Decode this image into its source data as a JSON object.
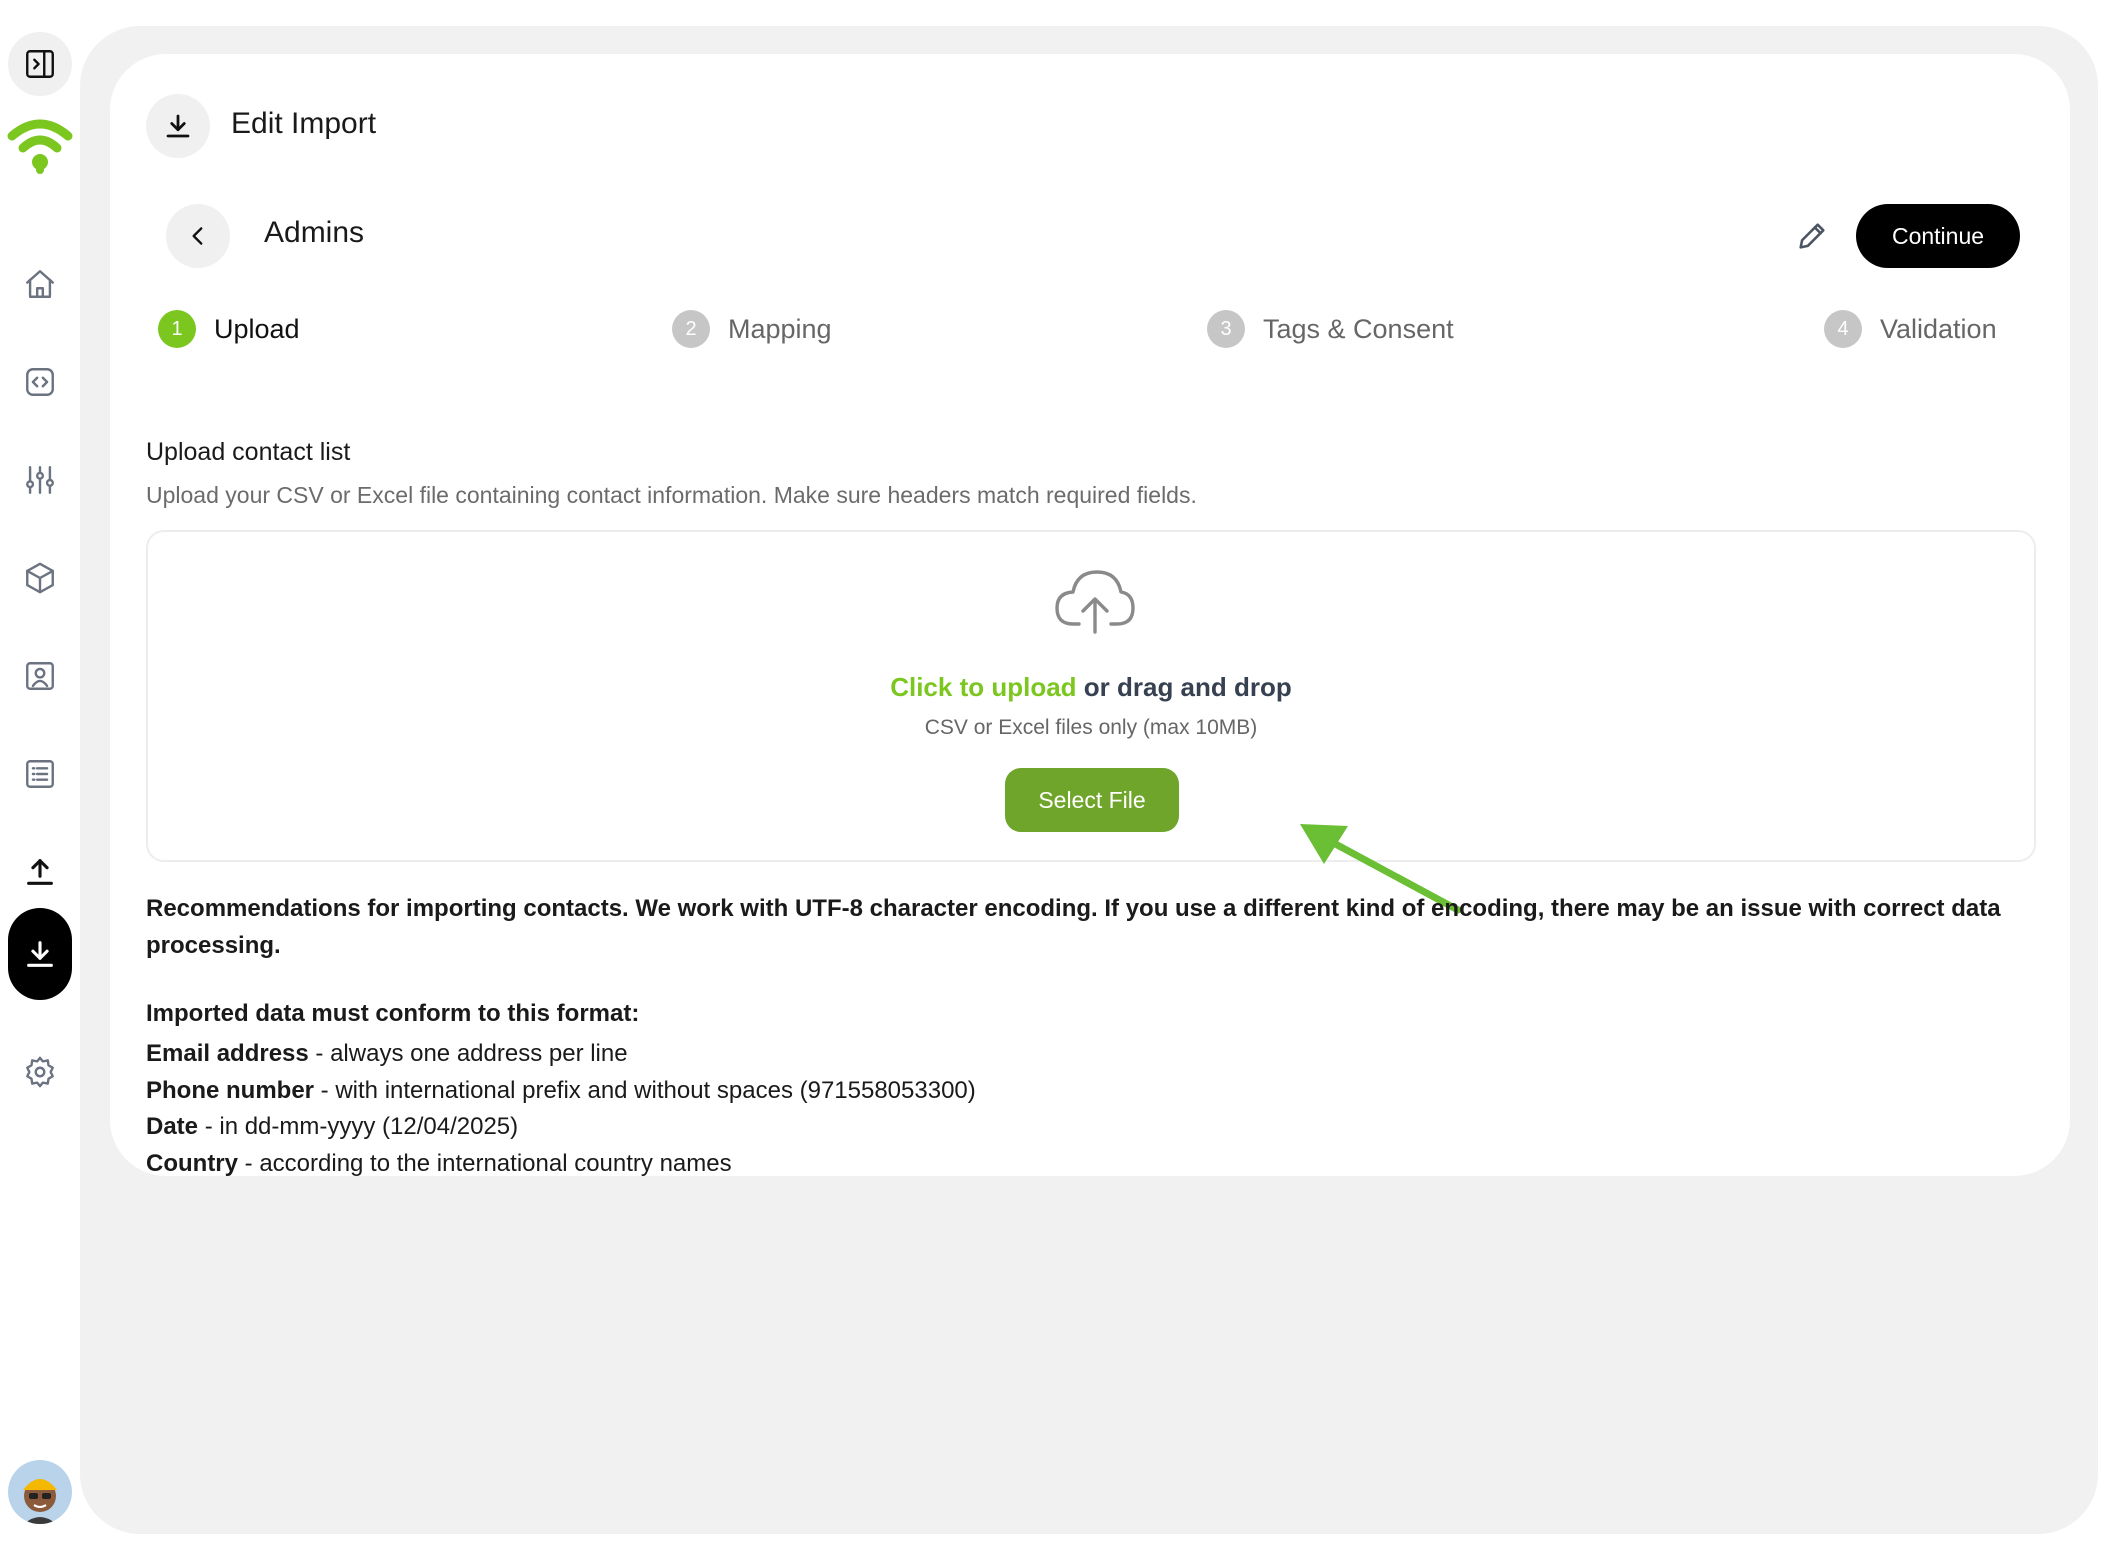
{
  "header": {
    "title": "Edit Import"
  },
  "list": {
    "name": "Admins",
    "continue_label": "Continue"
  },
  "steps": [
    {
      "num": "1",
      "label": "Upload"
    },
    {
      "num": "2",
      "label": "Mapping"
    },
    {
      "num": "3",
      "label": "Tags & Consent"
    },
    {
      "num": "4",
      "label": "Validation"
    }
  ],
  "upload": {
    "title": "Upload contact list",
    "description": "Upload your CSV or Excel file containing contact information. Make sure headers match required fields.",
    "click_text": "Click to upload",
    "drag_text": " or drag and drop",
    "note": "CSV or Excel files only (max 10MB)",
    "select_label": "Select File"
  },
  "recommendations": "Recommendations for importing contacts. We work with UTF-8 character encoding. If you use a different kind of encoding, there may be an issue with correct data processing.",
  "format": {
    "title": "Imported data must conform to this format:",
    "items": [
      {
        "key": "Email address",
        "value": " - always one address per line"
      },
      {
        "key": "Phone number",
        "value": " - with international prefix and without spaces (971558053300)"
      },
      {
        "key": "Date",
        "value": " - in dd-mm-yyyy (12/04/2025)"
      },
      {
        "key": "Country",
        "value": " - according to the international country names"
      }
    ]
  },
  "colors": {
    "accent": "#7cc71f",
    "button_green": "#6fa52a",
    "black": "#000000"
  },
  "icons": {
    "sidebar": [
      "sidebar-toggle-icon",
      "brand-logo",
      "home-icon",
      "code-icon",
      "sliders-icon",
      "box-icon",
      "contact-icon",
      "list-icon",
      "upload-icon",
      "download-icon",
      "gear-icon",
      "avatar"
    ]
  }
}
